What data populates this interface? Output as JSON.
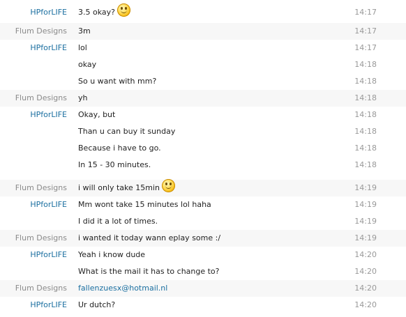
{
  "messages": [
    {
      "sender": "HPforLIFE",
      "text": "3.5 okay?",
      "time": "14:17",
      "emoticon": "smiley-icon"
    },
    {
      "sender": "Flum Designs",
      "text": "3m",
      "time": "14:17"
    },
    {
      "sender": "HPforLIFE",
      "text": "lol",
      "time": "14:17"
    },
    {
      "sender": "",
      "text": "okay",
      "time": "14:18"
    },
    {
      "sender": "",
      "text": "So u want with mm?",
      "time": "14:18"
    },
    {
      "sender": "Flum Designs",
      "text": "yh",
      "time": "14:18"
    },
    {
      "sender": "HPforLIFE",
      "text": "Okay, but",
      "time": "14:18"
    },
    {
      "sender": "",
      "text": "Than u can buy it sunday",
      "time": "14:18"
    },
    {
      "sender": "",
      "text": "Because i have to go.",
      "time": "14:18"
    },
    {
      "sender": "",
      "text": "In 15 - 30 minutes.",
      "time": "14:18"
    },
    {
      "sender": "Flum Designs",
      "text": "i will only take 15min",
      "time": "14:19",
      "emoticon": "smiley-icon"
    },
    {
      "sender": "HPforLIFE",
      "text": "Mm wont take 15 minutes lol haha",
      "time": "14:19"
    },
    {
      "sender": "",
      "text": "I did it a lot of times.",
      "time": "14:19"
    },
    {
      "sender": "Flum Designs",
      "text": "i wanted it today wann eplay some :/",
      "time": "14:19"
    },
    {
      "sender": "HPforLIFE",
      "text": "Yeah i know dude",
      "time": "14:20"
    },
    {
      "sender": "",
      "text": "What is the mail it has to change to?",
      "time": "14:20"
    },
    {
      "sender": "Flum Designs",
      "text": "fallenzuesx@hotmail.nl",
      "time": "14:20",
      "link": true
    },
    {
      "sender": "HPforLIFE",
      "text": "Ur dutch?",
      "time": "14:20"
    }
  ]
}
